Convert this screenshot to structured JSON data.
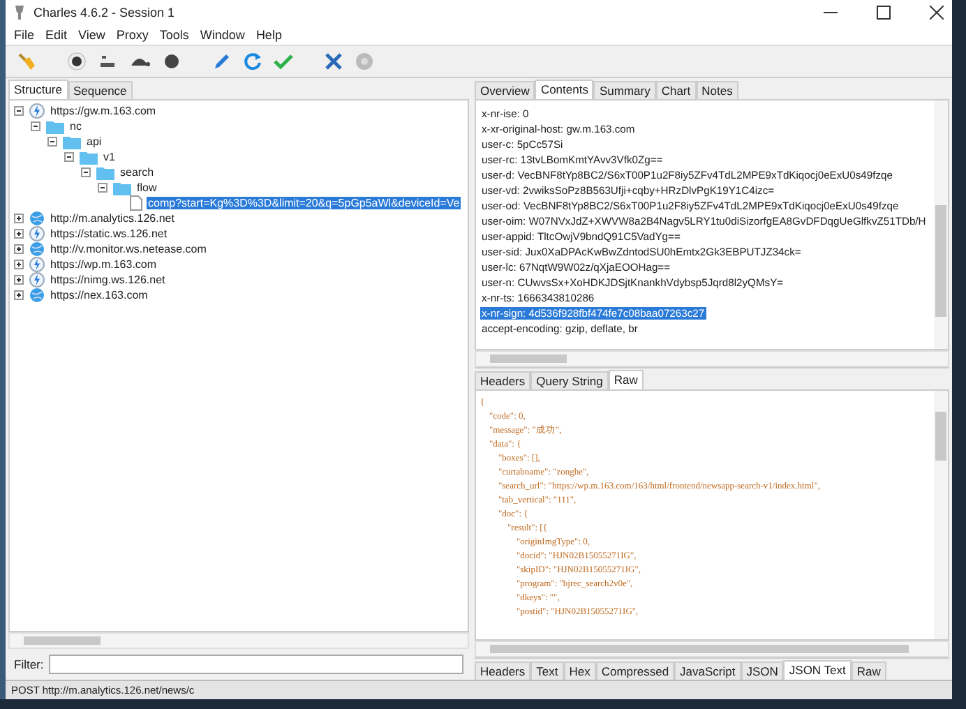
{
  "window": {
    "title": "Charles 4.6.2 - Session 1"
  },
  "menu": [
    "File",
    "Edit",
    "View",
    "Proxy",
    "Tools",
    "Window",
    "Help"
  ],
  "left_tabs": [
    {
      "label": "Structure",
      "selected": true
    },
    {
      "label": "Sequence",
      "selected": false
    }
  ],
  "tree": [
    {
      "label": "https://gw.m.163.com",
      "kind": "secure",
      "expanded": true,
      "selected": false,
      "children": [
        {
          "label": "nc",
          "kind": "folder",
          "expanded": true,
          "selected": false,
          "children": [
            {
              "label": "api",
              "kind": "folder",
              "expanded": true,
              "selected": false,
              "children": [
                {
                  "label": "v1",
                  "kind": "folder",
                  "expanded": true,
                  "selected": false,
                  "children": [
                    {
                      "label": "search",
                      "kind": "folder",
                      "expanded": true,
                      "selected": false,
                      "children": [
                        {
                          "label": "flow",
                          "kind": "folder",
                          "expanded": true,
                          "selected": false,
                          "children": [
                            {
                              "label": "comp?start=Kg%3D%3D&limit=20&q=5pGp5aWl&deviceId=Ve",
                              "kind": "file",
                              "selected": true
                            }
                          ]
                        }
                      ]
                    }
                  ]
                }
              ]
            }
          ]
        }
      ]
    },
    {
      "label": "http://m.analytics.126.net",
      "kind": "plain",
      "expanded": false,
      "selected": false
    },
    {
      "label": "https://static.ws.126.net",
      "kind": "secure",
      "expanded": false,
      "selected": false
    },
    {
      "label": "http://v.monitor.ws.netease.com",
      "kind": "plain",
      "expanded": false,
      "selected": false
    },
    {
      "label": "https://wp.m.163.com",
      "kind": "secure",
      "expanded": false,
      "selected": false
    },
    {
      "label": "https://nimg.ws.126.net",
      "kind": "secure",
      "expanded": false,
      "selected": false
    },
    {
      "label": "https://nex.163.com",
      "kind": "plain",
      "expanded": false,
      "selected": false
    }
  ],
  "filter": {
    "label": "Filter:"
  },
  "right_tabs": [
    {
      "label": "Overview",
      "selected": false
    },
    {
      "label": "Contents",
      "selected": true
    },
    {
      "label": "Summary",
      "selected": false
    },
    {
      "label": "Chart",
      "selected": false
    },
    {
      "label": "Notes",
      "selected": false
    }
  ],
  "request_lines": [
    {
      "text": "x-nr-ise: 0",
      "selected": false
    },
    {
      "text": "x-xr-original-host: gw.m.163.com",
      "selected": false
    },
    {
      "text": "user-c: 5pCc57Si",
      "selected": false
    },
    {
      "text": "user-rc: 13tvLBomKmtYAvv3Vfk0Zg==",
      "selected": false
    },
    {
      "text": "user-d: VecBNF8tYp8BC2/S6xT00P1u2F8iy5ZFv4TdL2MPE9xTdKiqocj0eExU0s49fzqe",
      "selected": false
    },
    {
      "text": "user-vd: 2vwiksSoPz8B563Ufji+cqby+HRzDlvPgK19Y1C4izc=",
      "selected": false
    },
    {
      "text": "user-od: VecBNF8tYp8BC2/S6xT00P1u2F8iy5ZFv4TdL2MPE9xTdKiqocj0eExU0s49fzqe",
      "selected": false
    },
    {
      "text": "user-oim: W07NVxJdZ+XWVW8a2B4Nagv5LRY1tu0diSizorfgEA8GvDFDqgUeGlfkvZ51TDb/H",
      "selected": false
    },
    {
      "text": "user-appid: TltcOwjV9bndQ91C5VadYg==",
      "selected": false
    },
    {
      "text": "user-sid: Jux0XaDPAcKwBwZdntodSU0hEmtx2Gk3EBPUTJZ34ck=",
      "selected": false
    },
    {
      "text": "user-lc: 67NqtW9W02z/qXjaEOOHag==",
      "selected": false
    },
    {
      "text": "user-n: CUwvsSx+XoHDKJDSjtKnankhVdybsp5Jqrd8l2yQMsY=",
      "selected": false
    },
    {
      "text": "x-nr-ts: 1666343810286",
      "selected": false
    },
    {
      "text": "x-nr-sign: 4d536f928fbf474fe7c08baa07263c27",
      "selected": true
    },
    {
      "text": "accept-encoding: gzip, deflate, br",
      "selected": false
    }
  ],
  "request_tabs": [
    {
      "label": "Headers",
      "selected": false
    },
    {
      "label": "Query String",
      "selected": false
    },
    {
      "label": "Raw",
      "selected": true
    }
  ],
  "response_lines": [
    "{",
    "    \"code\": 0,",
    "    \"message\": \"成功\",",
    "    \"data\": {",
    "        \"boxes\": [],",
    "        \"curtabname\": \"zonghe\",",
    "        \"search_url\": \"https://wp.m.163.com/163/html/frontend/newsapp-search-v1/index.html\",",
    "        \"tab_vertical\": \"111\",",
    "        \"doc\": {",
    "            \"result\": [{",
    "                \"originImgType\": 0,",
    "                \"docid\": \"HJN02B15055271IG\",",
    "                \"skipID\": \"HJN02B15055271IG\",",
    "                \"program\": \"bjrec_search2v0e\",",
    "                \"dkeys\": \"\",",
    "                \"postid\": \"HJN02B15055271IG\","
  ],
  "response_tabs": [
    {
      "label": "Headers",
      "selected": false
    },
    {
      "label": "Text",
      "selected": false
    },
    {
      "label": "Hex",
      "selected": false
    },
    {
      "label": "Compressed",
      "selected": false
    },
    {
      "label": "JavaScript",
      "selected": false
    },
    {
      "label": "JSON",
      "selected": false
    },
    {
      "label": "JSON Text",
      "selected": true
    },
    {
      "label": "Raw",
      "selected": false
    }
  ],
  "status_bar": {
    "text": "POST http://m.analytics.126.net/news/c"
  }
}
